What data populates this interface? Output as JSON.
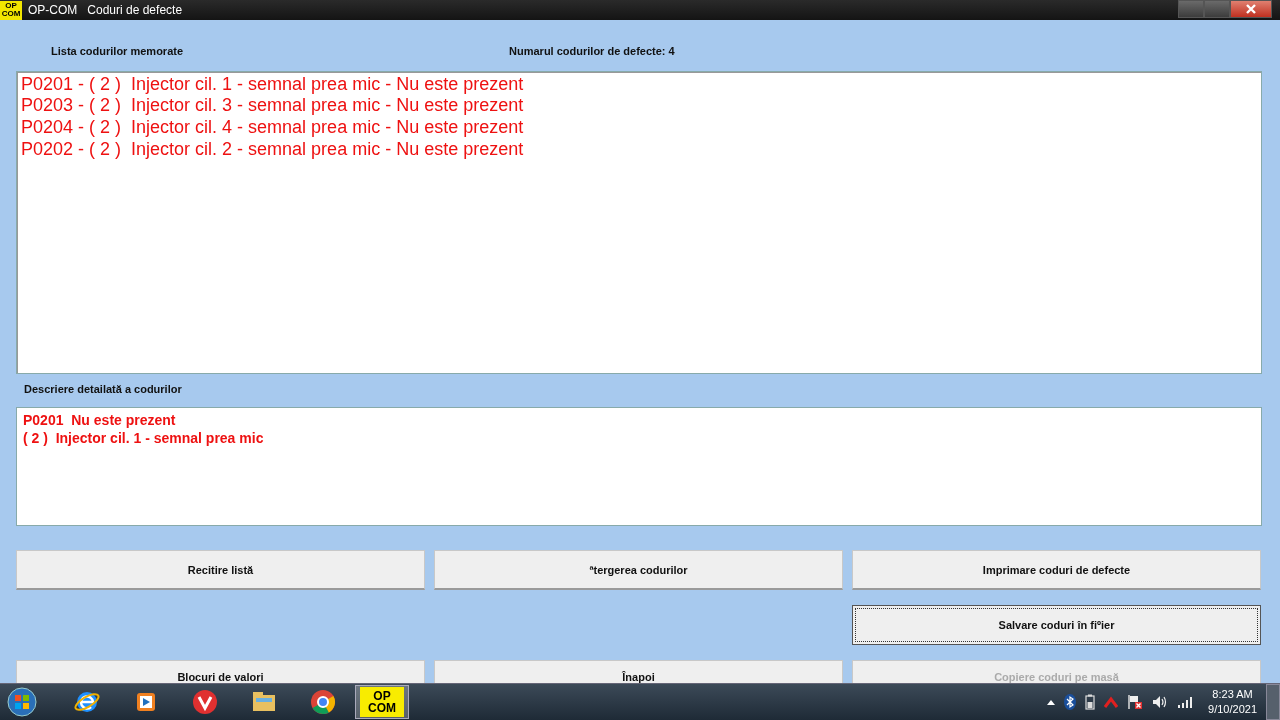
{
  "window": {
    "app_icon": "OP COM",
    "title": "OP-COM   Coduri de defecte"
  },
  "list_label": "Lista codurilor memorate",
  "count_label": "Numarul codurilor de defecte: 4",
  "codes": [
    {
      "text": "P0201 - ( 2 )  Injector cil. 1 - semnal prea mic - Nu este prezent",
      "selected": false
    },
    {
      "text": "P0203 - ( 2 )  Injector cil. 3 - semnal prea mic - Nu este prezent",
      "selected": false
    },
    {
      "text": "P0204 - ( 2 )  Injector cil. 4 - semnal prea mic - Nu este prezent",
      "selected": false
    },
    {
      "text": "P0202 - ( 2 )  Injector cil. 2 - semnal prea mic - Nu este prezent",
      "selected": false
    }
  ],
  "detail_label": "Descriere detailată a codurilor",
  "detail_lines": [
    "P0201  Nu este prezent",
    "( 2 )  Injector cil. 1 - semnal prea mic"
  ],
  "button_rows": [
    [
      {
        "label": "Recitire listă",
        "disabled": false,
        "focused": false
      },
      {
        "label": "ªtergerea codurilor",
        "disabled": false,
        "focused": false
      },
      {
        "label": "Imprimare coduri de defecte",
        "disabled": false,
        "focused": false
      }
    ],
    [
      null,
      null,
      {
        "label": "Salvare coduri în fiºier",
        "disabled": false,
        "focused": true
      }
    ],
    [
      {
        "label": "Blocuri de valori",
        "disabled": false,
        "focused": false
      },
      {
        "label": "Înapoi",
        "disabled": false,
        "focused": false
      },
      {
        "label": "Copiere coduri pe masă",
        "disabled": true,
        "focused": false
      }
    ]
  ],
  "taskbar": {
    "apps": [
      {
        "kind": "ie",
        "active": false
      },
      {
        "kind": "media",
        "active": false
      },
      {
        "kind": "vivaldi",
        "active": false
      },
      {
        "kind": "folder",
        "active": false
      },
      {
        "kind": "chrome",
        "active": false
      },
      {
        "kind": "opcom",
        "label": "OP COM",
        "active": true
      }
    ],
    "time": "8:23 AM",
    "date": "9/10/2021"
  }
}
